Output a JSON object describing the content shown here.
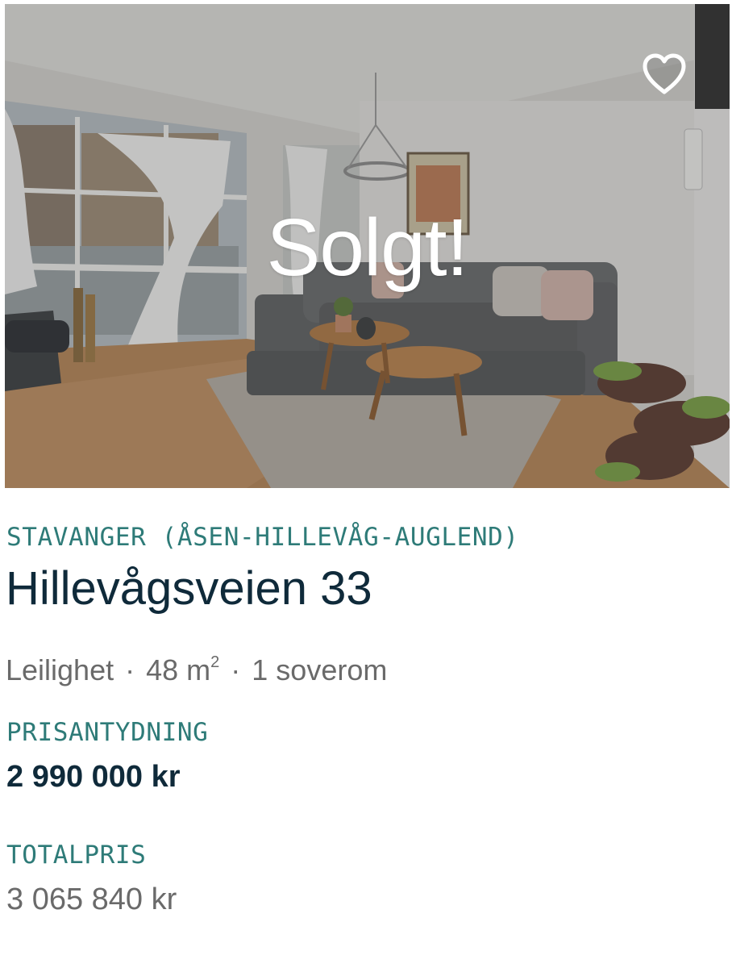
{
  "listing": {
    "status_overlay": "Solgt!",
    "favorite_icon": "heart-outline-icon",
    "location": "STAVANGER (ÅSEN-HILLEVÅG-AUGLEND)",
    "address": "Hillevågsveien 33",
    "property_type": "Leilighet",
    "separator": "·",
    "area_value": "48 m",
    "area_unit_sup": "2",
    "bedrooms": "1 soverom",
    "asking_price_label": "PRISANTYDNING",
    "asking_price": "2 990 000 kr",
    "total_price_label": "TOTALPRIS",
    "total_price": "3 065 840 kr"
  },
  "colors": {
    "accent_teal": "#2e7b78",
    "heading_navy": "#0f2a3a",
    "secondary_gray": "#6a6a6a"
  }
}
